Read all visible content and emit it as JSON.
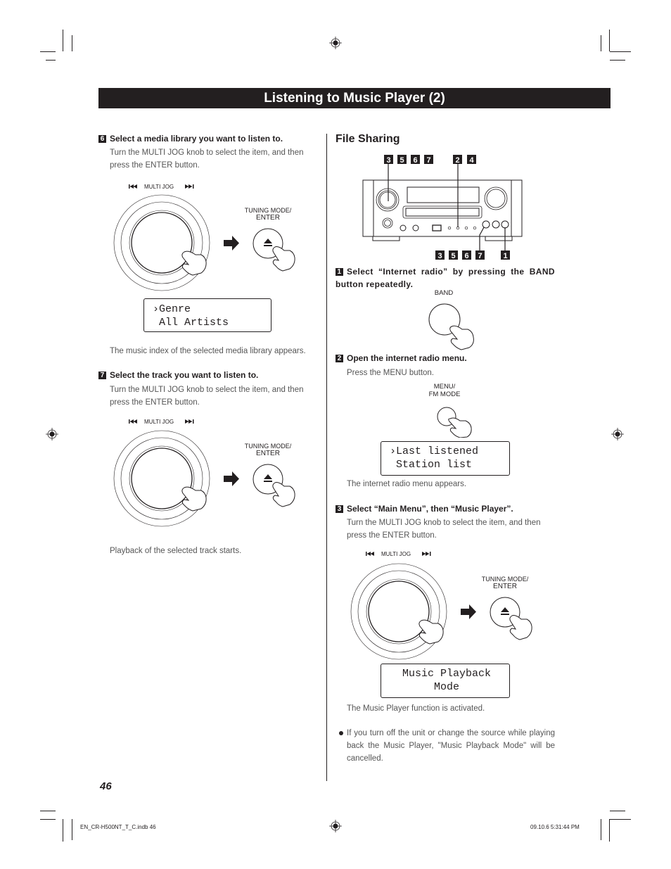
{
  "page": {
    "title": "Listening to Music Player (2)",
    "page_number": "46",
    "footer_left": "EN_CR-H500NT_T_C.indb   46",
    "footer_right": "09.10.6   5:31:44 PM"
  },
  "left": {
    "step6": {
      "number": "6",
      "title": "Select a media library you want to listen to.",
      "body": "Turn the MULTI JOG knob to select the item, and then press the ENTER button.",
      "jog_label": "MULTI JOG",
      "enter_label_1": "TUNING MODE/",
      "enter_label_2": "ENTER",
      "lcd_line1": "›Genre",
      "lcd_line2": " All Artists",
      "result": "The music index of the selected media library appears."
    },
    "step7": {
      "number": "7",
      "title": "Select the track you want to listen to.",
      "body": "Turn the MULTI JOG knob to select the item, and then press the ENTER button.",
      "jog_label": "MULTI JOG",
      "enter_label_1": "TUNING MODE/",
      "enter_label_2": "ENTER",
      "result": "Playback of the selected track starts."
    }
  },
  "right": {
    "heading": "File Sharing",
    "diagram": {
      "top_marks_left": [
        "3",
        "5",
        "6",
        "7"
      ],
      "top_marks_right": [
        "2",
        "4"
      ],
      "bottom_marks_left": [
        "3",
        "5",
        "6",
        "7"
      ],
      "bottom_marks_right": [
        "1"
      ]
    },
    "step1": {
      "number": "1",
      "title": "Select “Internet radio” by pressing the BAND button repeatedly.",
      "button_label": "BAND"
    },
    "step2": {
      "number": "2",
      "title": "Open the internet radio menu.",
      "body": "Press the MENU button.",
      "button_label_1": "MENU/",
      "button_label_2": "FM MODE",
      "lcd_line1": "›Last listened",
      "lcd_line2": " Station list",
      "result": "The internet radio menu appears."
    },
    "step3": {
      "number": "3",
      "title": "Select “Main Menu”, then “Music Player”.",
      "body": "Turn the MULTI JOG knob to select the item, and then press the ENTER button.",
      "jog_label": "MULTI JOG",
      "enter_label_1": "TUNING MODE/",
      "enter_label_2": "ENTER",
      "lcd_line1": "  Music Playback",
      "lcd_line2": "       Mode",
      "result": "The Music Player function is activated."
    },
    "note": "If you turn off the unit or change the source while playing back the Music Player, \"Music Playback Mode\" will be cancelled."
  },
  "icons": {
    "registration": "registration-mark-icon",
    "skip_back": "skip-back-icon",
    "skip_forward": "skip-forward-icon",
    "arrow": "arrow-right-icon",
    "eject": "eject-icon",
    "hand": "pointing-hand-icon",
    "bullet": "bullet-icon"
  }
}
